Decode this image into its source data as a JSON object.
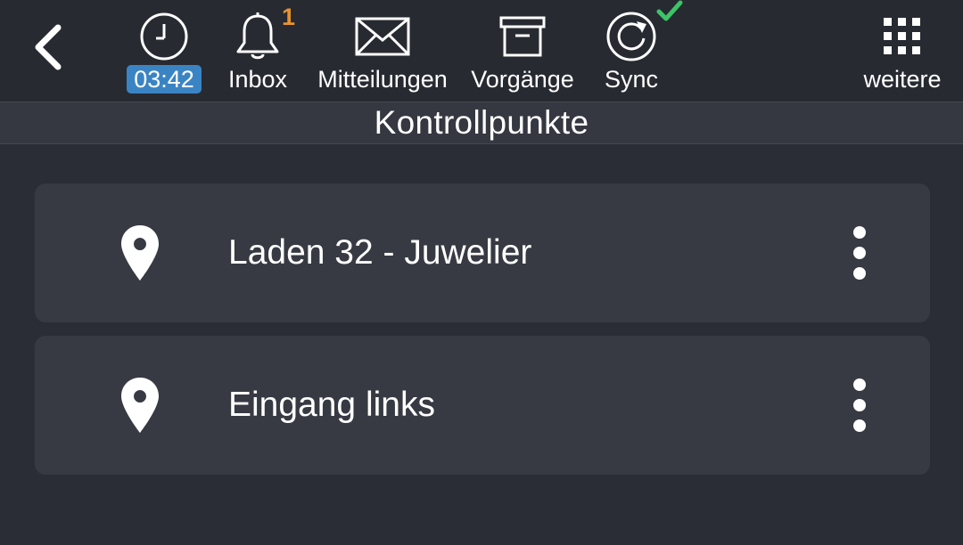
{
  "header": {
    "time": "03:42",
    "inbox": {
      "label": "Inbox",
      "count": "1"
    },
    "messages": {
      "label": "Mitteilungen"
    },
    "processes": {
      "label": "Vorgänge"
    },
    "sync": {
      "label": "Sync"
    },
    "more": {
      "label": "weitere"
    }
  },
  "page": {
    "title": "Kontrollpunkte"
  },
  "checkpoints": [
    {
      "label": "Laden 32 - Juwelier",
      "icon": "location-pin-icon"
    },
    {
      "label": "Eingang links",
      "icon": "location-pin-icon"
    }
  ],
  "colors": {
    "background": "#2a2d35",
    "card": "#373a42",
    "time_badge": "#3b84c4",
    "notification_count": "#e8932d",
    "sync_ok": "#3cc466"
  }
}
